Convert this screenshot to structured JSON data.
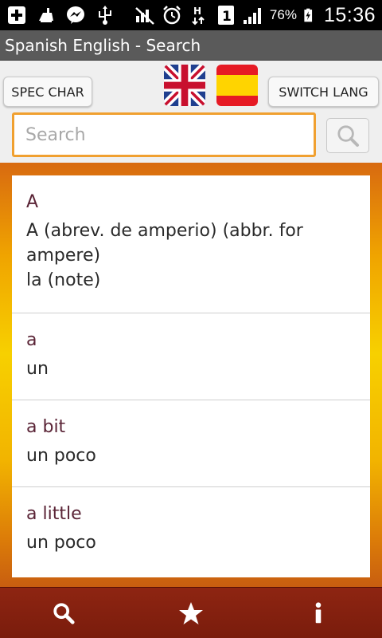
{
  "status_bar": {
    "battery": "76%",
    "time": "15:36",
    "left_icons": [
      "add-icon",
      "cleaner-icon",
      "messenger-icon",
      "usb-icon"
    ],
    "right_icons": [
      "no-signal-icon",
      "alarm-icon",
      "hspa-icon",
      "sim-1-icon",
      "signal-icon",
      "battery-charging-icon"
    ]
  },
  "app": {
    "title": "Spanish English - Search"
  },
  "toolbar": {
    "spec_char_label": "SPEC CHAR",
    "switch_lang_label": "SWITCH LANG",
    "flags": [
      "uk-flag-icon",
      "spain-flag-icon"
    ]
  },
  "search": {
    "placeholder": "Search",
    "value": ""
  },
  "results": [
    {
      "term": "A",
      "definition_lines": [
        "A (abrev. de amperio) (abbr. for",
        "ampere)",
        "la (note)"
      ]
    },
    {
      "term": "a",
      "definition_lines": [
        "un"
      ]
    },
    {
      "term": "a bit",
      "definition_lines": [
        "un poco"
      ]
    },
    {
      "term": "a little",
      "definition_lines": [
        "un poco"
      ]
    }
  ],
  "bottom_nav": {
    "items": [
      "search-icon",
      "favorites-star-icon",
      "info-icon"
    ]
  },
  "colors": {
    "search_border": "#f0a030",
    "term_text": "#5a2436",
    "bottom_nav": "#8e2512",
    "title_bar": "#5a5a5a"
  }
}
